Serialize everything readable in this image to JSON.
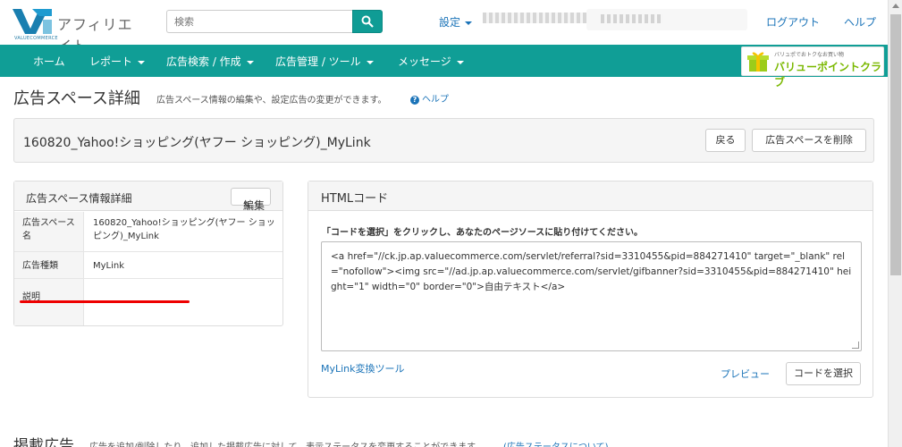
{
  "header": {
    "logo_text": "アフィリエイト",
    "logo_sub": "VALUECOMMERCE",
    "search_placeholder": "検索",
    "settings_label": "設定",
    "logout_label": "ログアウト",
    "help_label": "ヘルプ"
  },
  "nav": {
    "items": [
      {
        "label": "ホーム"
      },
      {
        "label": "レポート"
      },
      {
        "label": "広告検索 / 作成"
      },
      {
        "label": "広告管理 / ツール"
      },
      {
        "label": "メッセージ"
      }
    ],
    "banner_tag": "バリュポでおトクなお買い物",
    "banner_text": "バリューポイントクラブ"
  },
  "page": {
    "title": "広告スペース詳細",
    "description": "広告スペース情報の編集や、設定広告の変更ができます。",
    "help_label": "ヘルプ"
  },
  "space": {
    "name": "160820_Yahoo!ショッピング(ヤフー ショッピング)_MyLink",
    "back_label": "戻る",
    "delete_label": "広告スペースを削除"
  },
  "info": {
    "title": "広告スペース情報詳細",
    "edit_label": "編集",
    "rows": [
      {
        "label": "広告スペース名",
        "value": "160820_Yahoo!ショッピング(ヤフー ショッピング)_MyLink"
      },
      {
        "label": "広告種類",
        "value": "MyLink"
      },
      {
        "label": "説明",
        "value": ""
      }
    ]
  },
  "code": {
    "title": "HTMLコード",
    "instruction": "「コードを選択」をクリックし、あなたのページソースに貼り付けてください。",
    "text": "<a href=\"//ck.jp.ap.valuecommerce.com/servlet/referral?sid=3310455&pid=884271410\" target=\"_blank\" rel=\"nofollow\"><img src=\"//ad.jp.ap.valuecommerce.com/servlet/gifbanner?sid=3310455&pid=884271410\" height=\"1\" width=\"0\" border=\"0\">自由テキスト</a>",
    "mylink_label": "MyLink変換ツール",
    "preview_label": "プレビュー",
    "select_label": "コードを選択"
  },
  "ads": {
    "title": "掲載広告",
    "description": "広告を追加/削除したり、追加した掲載広告に対して、表示ステータスを変更することができます。",
    "status_link": "(広告ステータスについて)"
  },
  "colors": {
    "brand_teal": "#109e96",
    "link_blue": "#1a73b8",
    "highlight_red": "#e00000"
  }
}
